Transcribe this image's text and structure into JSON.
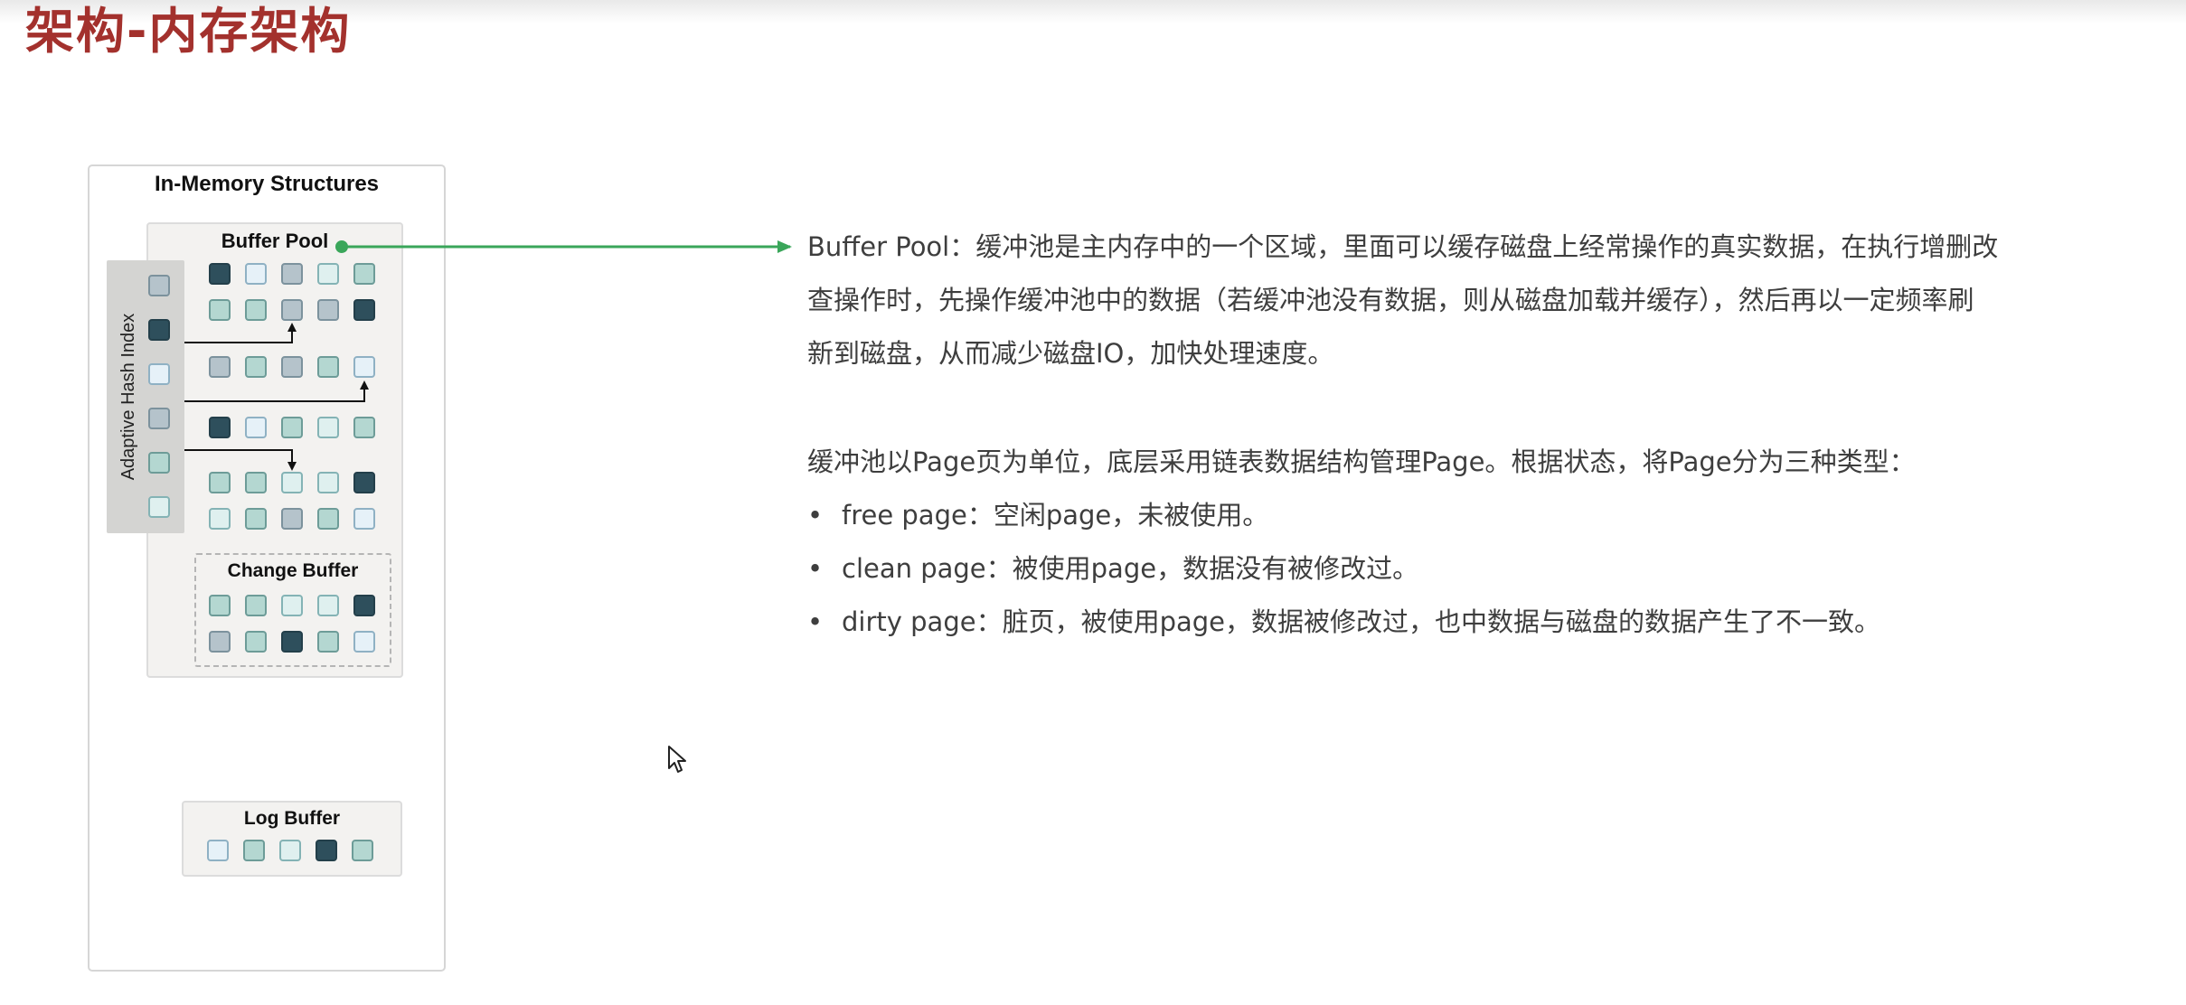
{
  "slide": {
    "title": "架构-内存架构"
  },
  "diagram": {
    "outer_title": "In-Memory Structures",
    "buffer_pool_label": "Buffer Pool",
    "adaptive_hash_index_label": "Adaptive Hash Index",
    "change_buffer_label": "Change Buffer",
    "log_buffer_label": "Log Buffer",
    "connector_color": "#3aa65a",
    "page_colors": {
      "dark": "#2e4f5c",
      "teal": "#b4d7d1",
      "grey": "#b5c3cb",
      "light": "#e6f1f8"
    }
  },
  "description": {
    "buffer_pool_paragraph_line1": "Buffer Pool：缓冲池是主内存中的一个区域，里面可以缓存磁盘上经常操作的真实数据，在执行增删改",
    "buffer_pool_paragraph_line2": "查操作时，先操作缓冲池中的数据（若缓冲池没有数据，则从磁盘加载并缓存），然后再以一定频率刷",
    "buffer_pool_paragraph_line3": "新到磁盘，从而减少磁盘IO，加快处理速度。",
    "page_types_intro": "缓冲池以Page页为单位，底层采用链表数据结构管理Page。根据状态，将Page分为三种类型：",
    "bullets": [
      "free page：空闲page，未被使用。",
      "clean page：被使用page，数据没有被修改过。",
      "dirty page：脏页，被使用page，数据被修改过，也中数据与磁盘的数据产生了不一致。"
    ],
    "bullet_symbol": "•"
  }
}
